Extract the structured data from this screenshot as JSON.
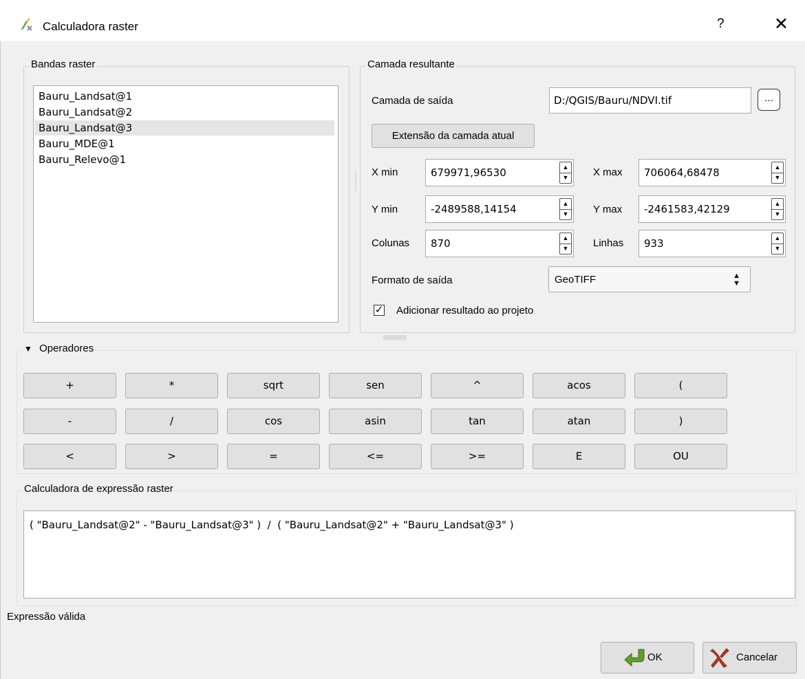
{
  "window": {
    "title": "Calculadora raster",
    "help_label": "?",
    "close_label": "✕"
  },
  "bands": {
    "group_title": "Bandas raster",
    "items": [
      "Bauru_Landsat@1",
      "Bauru_Landsat@2",
      "Bauru_Landsat@3",
      "Bauru_MDE@1",
      "Bauru_Relevo@1"
    ],
    "selected": "Bauru_Landsat@3"
  },
  "result": {
    "group_title": "Camada resultante",
    "output_label": "Camada de saída",
    "output_value": "D:/QGIS/Bauru/NDVI.tif",
    "browse_label": "...",
    "extent_button": "Extensão da camada atual",
    "xmin_label": "X min",
    "xmin_value": "679971,96530",
    "xmax_label": "X max",
    "xmax_value": "706064,68478",
    "ymin_label": "Y min",
    "ymin_value": "-2489588,14154",
    "ymax_label": "Y max",
    "ymax_value": "-2461583,42129",
    "cols_label": "Colunas",
    "cols_value": "870",
    "rows_label": "Linhas",
    "rows_value": "933",
    "format_label": "Formato de saída",
    "format_value": "GeoTIFF",
    "add_to_project_label": "Adicionar resultado ao projeto",
    "add_to_project_checked": true
  },
  "operators": {
    "group_title": "Operadores",
    "rows": [
      [
        "+",
        "*",
        "sqrt",
        "sen",
        "^",
        "acos",
        "("
      ],
      [
        "-",
        "/",
        "cos",
        "asin",
        "tan",
        "atan",
        ")"
      ],
      [
        "<",
        ">",
        "=",
        "<=",
        ">=",
        "E",
        "OU"
      ]
    ]
  },
  "expression": {
    "group_title": "Calculadora de expressão raster",
    "text": "( \"Bauru_Landsat@2\" - \"Bauru_Landsat@3\" )  /  ( \"Bauru_Landsat@2\" + \"Bauru_Landsat@3\" )"
  },
  "status": "Expressão válida",
  "footer": {
    "ok_label": "OK",
    "cancel_label": "Cancelar"
  },
  "colors": {
    "ok_icon": "#5f9e2f",
    "cancel_icon": "#c0392b",
    "title_icon": "#6aa84f"
  }
}
